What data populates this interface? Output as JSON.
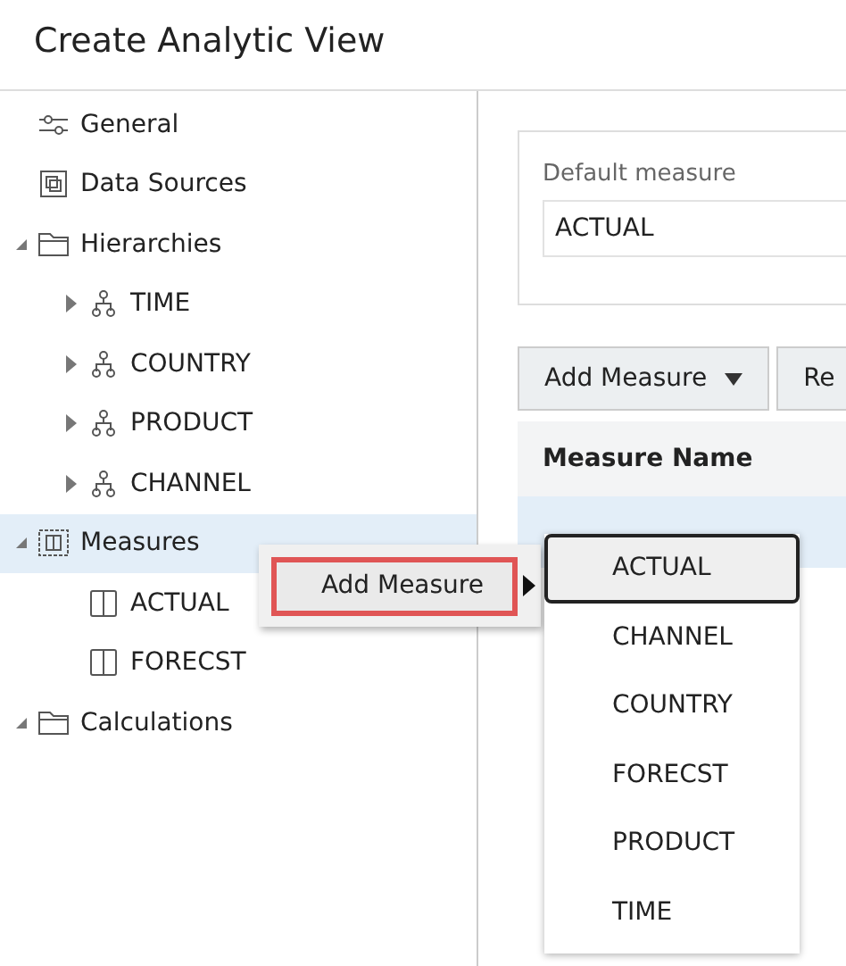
{
  "window": {
    "title": "Create Analytic View"
  },
  "tree": [
    {
      "label": "General",
      "kind": "settings",
      "selected": false
    },
    {
      "label": "Data Sources",
      "kind": "source",
      "selected": false
    },
    {
      "label": "Hierarchies",
      "kind": "folder",
      "selected": false,
      "expanded": true,
      "children": [
        {
          "label": "TIME",
          "kind": "hierarchy",
          "selected": false,
          "expanded": false
        },
        {
          "label": "COUNTRY",
          "kind": "hierarchy",
          "selected": false,
          "expanded": false
        },
        {
          "label": "PRODUCT",
          "kind": "hierarchy",
          "selected": false,
          "expanded": false
        },
        {
          "label": "CHANNEL",
          "kind": "hierarchy",
          "selected": false,
          "expanded": false
        }
      ]
    },
    {
      "label": "Measures",
      "kind": "measures",
      "selected": true,
      "expanded": true,
      "children": [
        {
          "label": "ACTUAL",
          "kind": "measure",
          "selected": false
        },
        {
          "label": "FORECST",
          "kind": "measure",
          "selected": false
        }
      ]
    },
    {
      "label": "Calculations",
      "kind": "folder",
      "selected": false,
      "expanded": true
    }
  ],
  "default_measure": {
    "label": "Default measure",
    "value": "ACTUAL"
  },
  "toolbar": [
    {
      "label": "Add Measure",
      "dropdown": true
    },
    {
      "label": "Re",
      "dropdown": false
    }
  ],
  "table": {
    "columns": [
      "Measure Name"
    ]
  },
  "context_menu": {
    "items": [
      {
        "label": "Add Measure",
        "selected": true
      }
    ]
  },
  "submenu": {
    "items": [
      {
        "label": "ACTUAL",
        "selected": true
      },
      {
        "label": "CHANNEL",
        "selected": false
      },
      {
        "label": "COUNTRY",
        "selected": false
      },
      {
        "label": "FORECST",
        "selected": false
      },
      {
        "label": "PRODUCT",
        "selected": false
      },
      {
        "label": "TIME",
        "selected": false
      }
    ]
  }
}
